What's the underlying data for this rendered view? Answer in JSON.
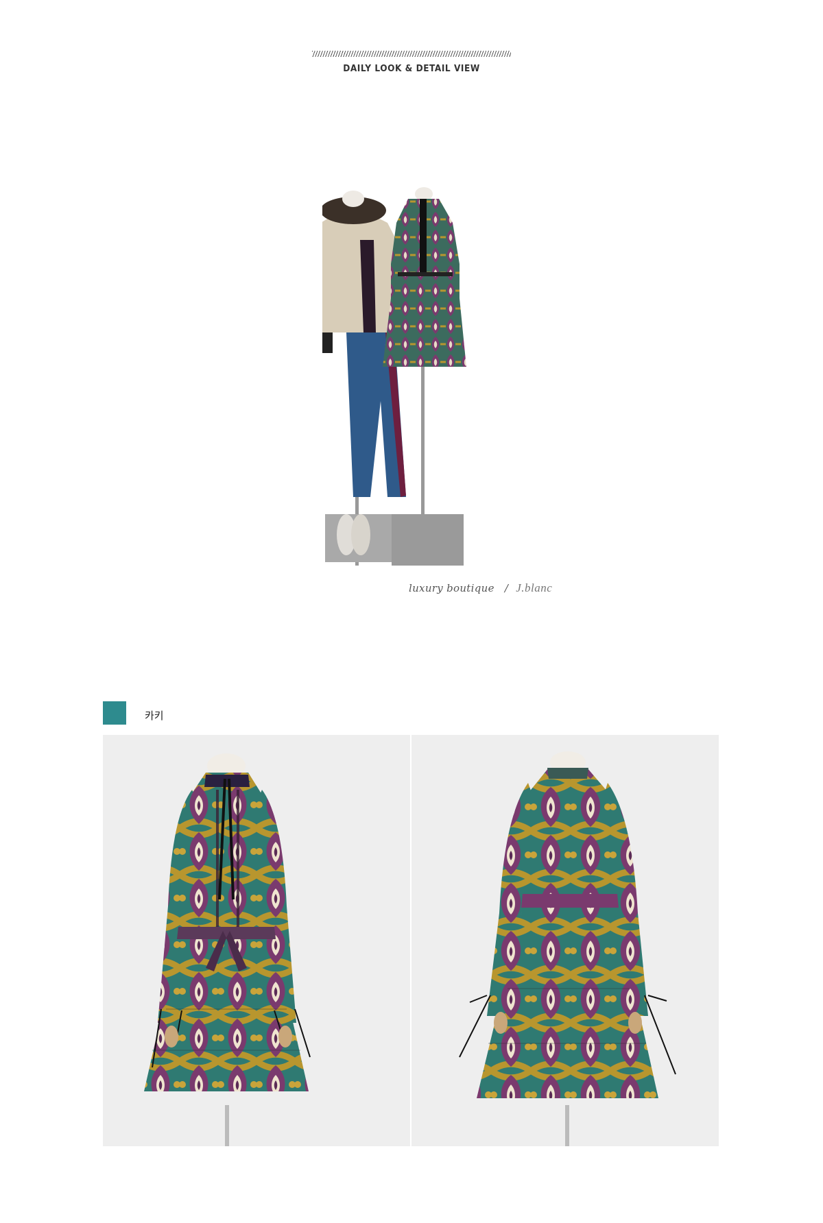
{
  "header": {
    "title": "DAILY LOOK & DETAIL VIEW"
  },
  "daily_look": {
    "caption": "luxury boutique",
    "separator": "/",
    "signature": "J.blanc"
  },
  "color_option": {
    "swatch_color": "#2e8b8e",
    "name": "카키"
  },
  "detail_images": [
    {
      "view": "front"
    },
    {
      "view": "back"
    }
  ]
}
